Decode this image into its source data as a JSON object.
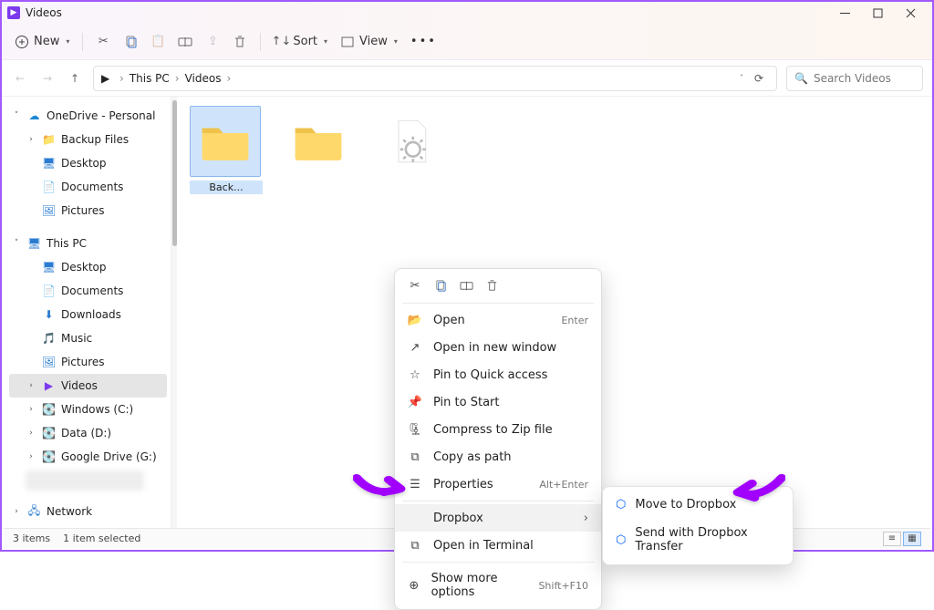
{
  "title": "Videos",
  "toolbar": {
    "new": "New",
    "sort": "Sort",
    "view": "View"
  },
  "breadcrumb": {
    "root": "This PC",
    "current": "Videos"
  },
  "search_placeholder": "Search Videos",
  "sidebar": {
    "onedrive": "OneDrive - Personal",
    "onedrive_children": [
      "Backup Files",
      "Desktop",
      "Documents",
      "Pictures"
    ],
    "thispc": "This PC",
    "thispc_children": [
      "Desktop",
      "Documents",
      "Downloads",
      "Music",
      "Pictures",
      "Videos",
      "Windows (C:)",
      "Data (D:)",
      "Google Drive (G:)"
    ],
    "network": "Network"
  },
  "files": {
    "selected_folder": "Back..."
  },
  "context_menu": {
    "open": "Open",
    "open_hint": "Enter",
    "open_new_window": "Open in new window",
    "pin_quick": "Pin to Quick access",
    "pin_start": "Pin to Start",
    "compress": "Compress to Zip file",
    "copy_path": "Copy as path",
    "properties": "Properties",
    "properties_hint": "Alt+Enter",
    "dropbox": "Dropbox",
    "terminal": "Open in Terminal",
    "more": "Show more options",
    "more_hint": "Shift+F10"
  },
  "submenu": {
    "move": "Move to Dropbox",
    "send": "Send with Dropbox Transfer"
  },
  "status": {
    "count": "3 items",
    "selected": "1 item selected"
  }
}
